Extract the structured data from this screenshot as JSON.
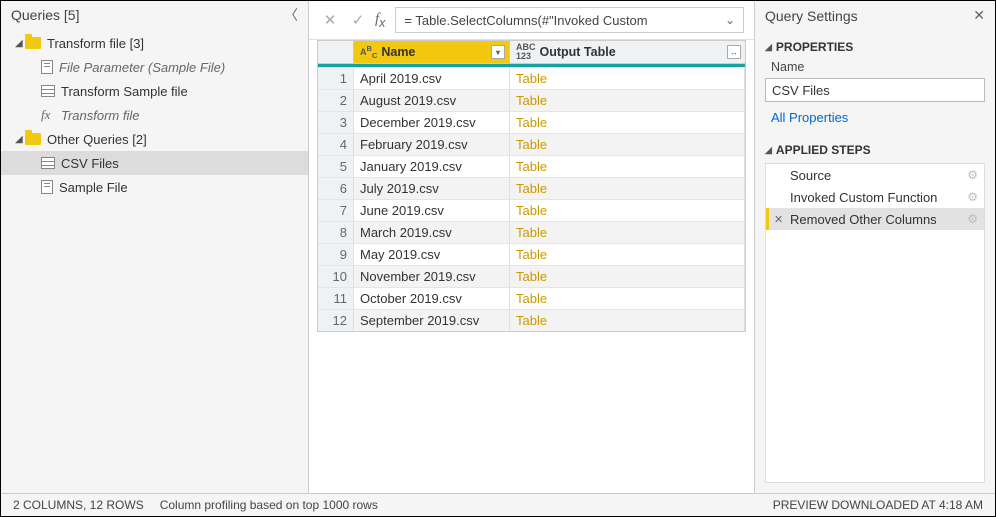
{
  "queries": {
    "title": "Queries [5]",
    "groups": [
      {
        "label": "Transform file [3]",
        "items": [
          {
            "label": "File Parameter (Sample File)",
            "kind": "param",
            "italic": true
          },
          {
            "label": "Transform Sample file",
            "kind": "table"
          },
          {
            "label": "Transform file",
            "kind": "fx",
            "italic": true
          }
        ]
      },
      {
        "label": "Other Queries [2]",
        "items": [
          {
            "label": "CSV Files",
            "kind": "table",
            "selected": true
          },
          {
            "label": "Sample File",
            "kind": "param"
          }
        ]
      }
    ]
  },
  "formula": "= Table.SelectColumns(#\"Invoked Custom",
  "grid": {
    "columns": [
      {
        "label": "Name",
        "type": "ABC"
      },
      {
        "label": "Output Table",
        "type": "ABC123"
      }
    ],
    "rows": [
      {
        "n": "1",
        "name": "April 2019.csv",
        "out": "Table"
      },
      {
        "n": "2",
        "name": "August 2019.csv",
        "out": "Table"
      },
      {
        "n": "3",
        "name": "December 2019.csv",
        "out": "Table"
      },
      {
        "n": "4",
        "name": "February 2019.csv",
        "out": "Table"
      },
      {
        "n": "5",
        "name": "January 2019.csv",
        "out": "Table"
      },
      {
        "n": "6",
        "name": "July 2019.csv",
        "out": "Table"
      },
      {
        "n": "7",
        "name": "June 2019.csv",
        "out": "Table"
      },
      {
        "n": "8",
        "name": "March 2019.csv",
        "out": "Table"
      },
      {
        "n": "9",
        "name": "May 2019.csv",
        "out": "Table"
      },
      {
        "n": "10",
        "name": "November 2019.csv",
        "out": "Table"
      },
      {
        "n": "11",
        "name": "October 2019.csv",
        "out": "Table"
      },
      {
        "n": "12",
        "name": "September 2019.csv",
        "out": "Table"
      }
    ]
  },
  "settings": {
    "title": "Query Settings",
    "properties_head": "PROPERTIES",
    "name_label": "Name",
    "name_value": "CSV Files",
    "all_props": "All Properties",
    "applied_head": "APPLIED STEPS",
    "steps": [
      {
        "label": "Source",
        "gear": true
      },
      {
        "label": "Invoked Custom Function",
        "gear": true
      },
      {
        "label": "Removed Other Columns",
        "selected": true,
        "close": true,
        "gear": true
      }
    ]
  },
  "status": {
    "cols_rows": "2 COLUMNS, 12 ROWS",
    "profiling": "Column profiling based on top 1000 rows",
    "preview": "PREVIEW DOWNLOADED AT 4:18 AM"
  }
}
